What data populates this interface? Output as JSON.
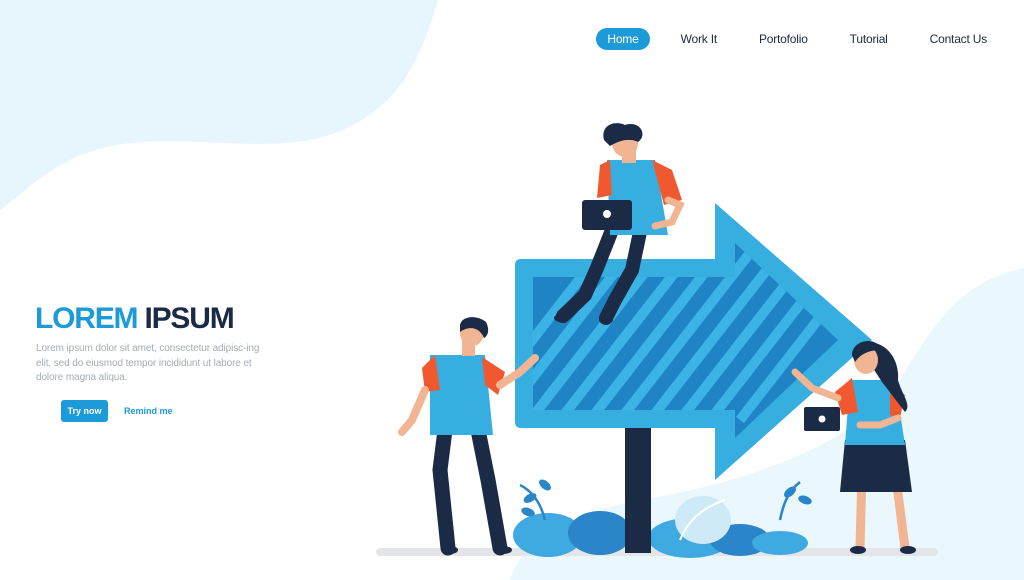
{
  "nav": {
    "items": [
      {
        "label": "Home",
        "active": true
      },
      {
        "label": "Work It",
        "active": false
      },
      {
        "label": "Portofolio",
        "active": false
      },
      {
        "label": "Tutorial",
        "active": false
      },
      {
        "label": "Contact Us",
        "active": false
      }
    ]
  },
  "hero": {
    "title_part1": "LOREM",
    "title_part2": "IPSUM",
    "body": "Lorem ipsum dolor sit amet, consectetur adipisc-ing elit, sed do eiusmod tempor incididunt ut labore et dolore magna aliqua.",
    "primary_button": "Try now",
    "secondary_link": "Remind me"
  },
  "colors": {
    "accent": "#1c9bd8",
    "dark": "#1b2a45",
    "light_bg": "#e6f6fc",
    "arrow": "#37aee0",
    "shirt_orange": "#f0592f"
  },
  "illustration": {
    "icons": [
      "arrow-signpost",
      "person-with-laptop",
      "person-pointing",
      "person-with-tablet",
      "leaf-plants"
    ]
  }
}
